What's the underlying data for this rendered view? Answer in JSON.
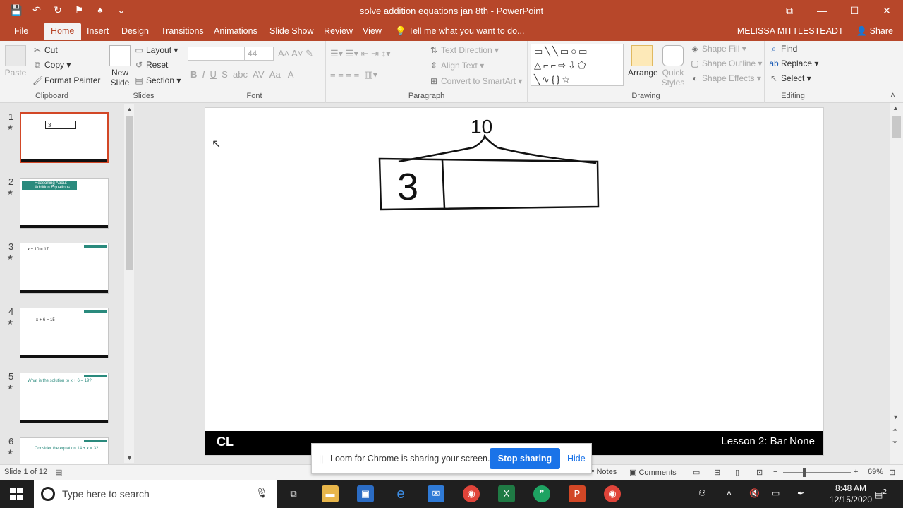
{
  "window": {
    "title": "solve addition equations jan 8th - PowerPoint",
    "controls": {
      "restore": "⧉",
      "minimize": "—",
      "maximize": "☐",
      "close": "✕"
    }
  },
  "qat": [
    "💾",
    "↶",
    "↻",
    "⚑",
    "♠",
    "⌄"
  ],
  "tabs": [
    "File",
    "Home",
    "Insert",
    "Design",
    "Transitions",
    "Animations",
    "Slide Show",
    "Review",
    "View"
  ],
  "tell_me": "Tell me what you want to do...",
  "user": {
    "name": "MELISSA MITTLESTEADT",
    "share": "Share"
  },
  "ribbon": {
    "clipboard": {
      "label": "Clipboard",
      "paste": "Paste",
      "cut": "Cut",
      "copy": "Copy",
      "format_painter": "Format Painter"
    },
    "slides": {
      "label": "Slides",
      "new_slide": "New Slide",
      "layout": "Layout",
      "reset": "Reset",
      "section": "Section"
    },
    "font": {
      "label": "Font",
      "size": "44"
    },
    "paragraph": {
      "label": "Paragraph",
      "text_direction": "Text Direction",
      "align_text": "Align Text",
      "smartart": "Convert to SmartArt"
    },
    "drawing": {
      "label": "Drawing",
      "arrange": "Arrange",
      "quick_styles": "Quick Styles",
      "shape_fill": "Shape Fill",
      "shape_outline": "Shape Outline",
      "shape_effects": "Shape Effects"
    },
    "editing": {
      "label": "Editing",
      "find": "Find",
      "replace": "Replace",
      "select": "Select"
    }
  },
  "thumbnails": [
    {
      "num": "1",
      "text": ""
    },
    {
      "num": "2",
      "text": "Reasoning About Addition Equations"
    },
    {
      "num": "3",
      "text": "x + 10 = 17"
    },
    {
      "num": "4",
      "text": "x + 6 = 15"
    },
    {
      "num": "5",
      "text": "What is the solution to x + 6 = 19?"
    },
    {
      "num": "6",
      "text": "Consider the equation 14 + x = 32."
    }
  ],
  "slide": {
    "drawing": {
      "total_label": "10",
      "part_label": "3"
    },
    "footer_logo": "CL",
    "footer_text": "Lesson 2: Bar None"
  },
  "loom": {
    "message": "Loom for Chrome is sharing your screen.",
    "stop": "Stop sharing",
    "hide": "Hide"
  },
  "status": {
    "slide": "Slide 1 of 12",
    "notes": "Notes",
    "comments": "Comments",
    "zoom": "69%"
  },
  "taskbar": {
    "search_placeholder": "Type here to search",
    "time": "8:48 AM",
    "date": "12/15/2020",
    "notif_count": "2"
  },
  "colors": {
    "ppt_brand": "#b7472a",
    "loom_blue": "#1a73e8"
  }
}
